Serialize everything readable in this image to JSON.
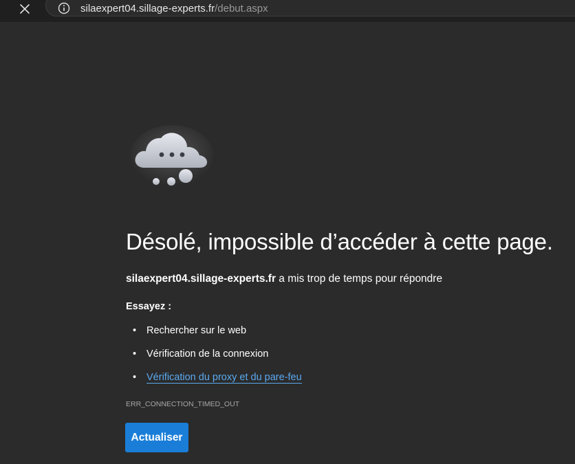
{
  "browser": {
    "url_host": "silaexpert04.sillage-experts.fr",
    "url_path": "/debut.aspx",
    "close_icon": "close-icon",
    "info_icon": "info-icon"
  },
  "error_page": {
    "illustration_icon": "cloud-timeout-icon",
    "title": "Désolé, impossible d’accéder à cette page.",
    "host": "silaexpert04.sillage-experts.fr",
    "message": " a mis trop de temps pour répondre",
    "try_label": "Essayez :",
    "bullet": "•",
    "suggestions": [
      "Rechercher sur le web",
      "Vérification de la connexion",
      "Vérification du proxy et du pare-feu"
    ],
    "error_code": "ERR_CONNECTION_TIMED_OUT",
    "refresh_label": "Actualiser",
    "colors": {
      "background": "#2b2b2b",
      "link": "#5aa9f0",
      "button": "#1a7ed8"
    }
  }
}
